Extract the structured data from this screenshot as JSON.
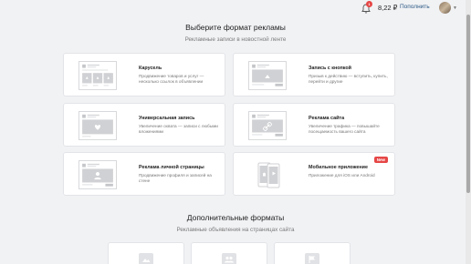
{
  "header": {
    "notification_count": "1",
    "balance": "8,22 ₽",
    "topup_label": "Пополнить"
  },
  "section_main": {
    "title": "Выберите формат рекламы",
    "subtitle": "Рекламные записи в новостной ленте"
  },
  "formats": [
    {
      "name": "Карусель",
      "description": "Продвижение товаров и услуг — несколько ссылок в объявлении"
    },
    {
      "name": "Запись с кнопкой",
      "description": "Призыв к действию — вступить, купить, перейти и другие"
    },
    {
      "name": "Универсальная запись",
      "description": "Увеличение охвата — записи с любыми вложениями"
    },
    {
      "name": "Реклама сайта",
      "description": "Увеличение трафика — повышайте посещаемость вашего сайта"
    },
    {
      "name": "Реклама личной страницы",
      "description": "Продвижение профиля и записей на стене"
    },
    {
      "name": "Мобильное приложение",
      "description": "Приложение для iOS или Android",
      "badge": "New"
    }
  ],
  "section_additional": {
    "title": "Дополнительные форматы",
    "subtitle": "Рекламные объявления на страницах сайта"
  },
  "icons": {
    "bell": "bell-icon",
    "avatar": "user-avatar",
    "chevron": "chevron-down-icon"
  },
  "colors": {
    "accent": "#2a5885",
    "badge_red": "#e64646",
    "background": "#f1f2f4"
  }
}
